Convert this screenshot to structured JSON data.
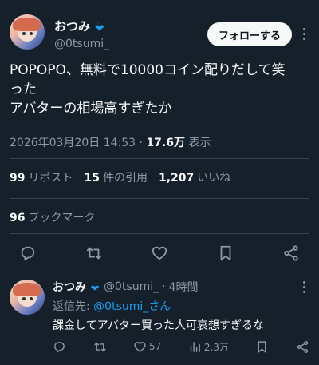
{
  "main_tweet": {
    "author_name": "おつみ",
    "author_handle": "@0tsumi_",
    "follow_label": "フォローする",
    "text_lines": [
      "POPOPO、無料で10000コイン配りだして笑",
      "った",
      "アバターの相場高すぎたか"
    ],
    "timestamp": "2026年03月20日 14:53",
    "separator": "·",
    "views_count": "17.6万",
    "views_label": "表示",
    "reposts_count": "99",
    "reposts_label": "リポスト",
    "quotes_count": "15",
    "quotes_label": "件の引用",
    "likes_count": "1,207",
    "likes_label": "いいね",
    "bookmarks_count": "96",
    "bookmarks_label": "ブックマーク"
  },
  "reply": {
    "author_name": "おつみ",
    "author_handle": "@0tsumi_",
    "separator": "·",
    "time_ago": "4時間",
    "reply_prefix": "返信先:",
    "reply_to": "@0tsumi_",
    "reply_suffix": "さん",
    "text": "課金してアバター買った人可哀想すぎるな",
    "likes_count": "57",
    "views_count": "2.3万"
  },
  "colors": {
    "background": "#15202b",
    "text": "#f7f9f9",
    "muted": "#8b98a5",
    "accent": "#1d9bf0",
    "divider": "#38444d"
  },
  "icons": [
    "verified-badge-icon",
    "more-icon",
    "reply-icon",
    "repost-icon",
    "like-icon",
    "bookmark-icon",
    "share-icon",
    "views-icon"
  ]
}
